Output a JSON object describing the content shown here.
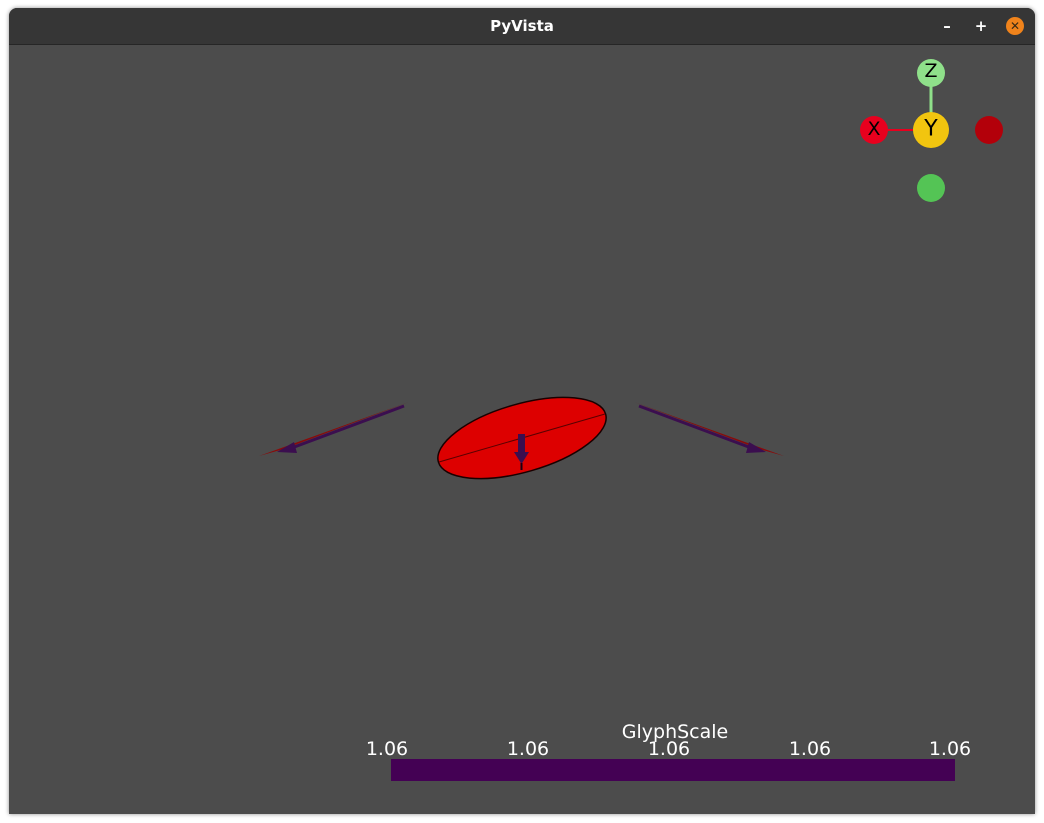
{
  "window": {
    "title": "PyVista",
    "minimize_symbol": "–",
    "maximize_symbol": "+",
    "close_symbol": "✕"
  },
  "axes_widget": {
    "x_label": "X",
    "y_label": "Y",
    "z_label": "Z",
    "colors": {
      "x": "#e8001e",
      "y": "#f2c50f",
      "z": "#8fe08a",
      "neg_y": "#54c455",
      "neg_x": "#b3000a"
    }
  },
  "scene": {
    "glyph_color": "#dd0000",
    "arrow_shaft_color": "#3b0e4f",
    "background": "#4c4c4c"
  },
  "scalar_bar": {
    "title": "GlyphScale",
    "ticks": [
      "1.06",
      "1.06",
      "1.06",
      "1.06",
      "1.06"
    ],
    "color": "#440154"
  }
}
